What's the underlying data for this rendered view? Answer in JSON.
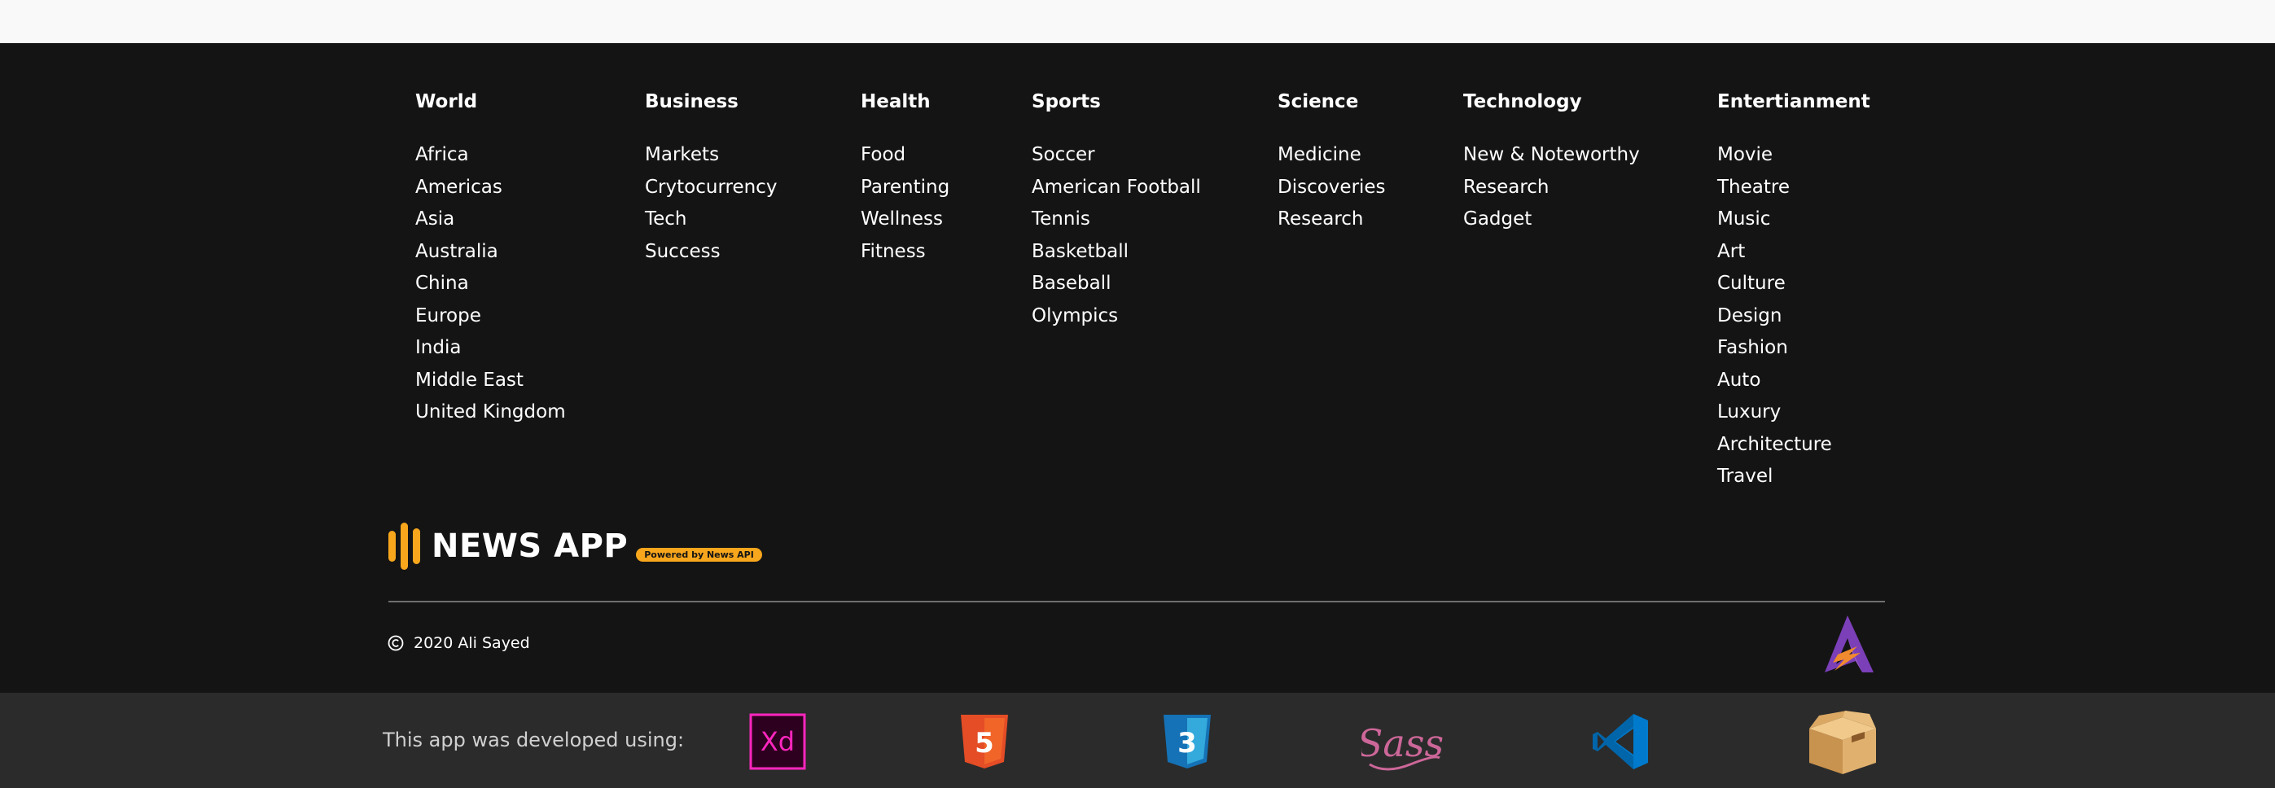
{
  "footer": {
    "columns": [
      {
        "heading": "World",
        "items": [
          "Africa",
          "Americas",
          "Asia",
          "Australia",
          "China",
          "Europe",
          "India",
          "Middle East",
          "United Kingdom"
        ]
      },
      {
        "heading": "Business",
        "items": [
          "Markets",
          "Crytocurrency",
          "Tech",
          "Success"
        ]
      },
      {
        "heading": "Health",
        "items": [
          "Food",
          "Parenting",
          "Wellness",
          "Fitness"
        ]
      },
      {
        "heading": "Sports",
        "items": [
          "Soccer",
          "American Football",
          "Tennis",
          "Basketball",
          "Baseball",
          "Olympics"
        ]
      },
      {
        "heading": "Science",
        "items": [
          "Medicine",
          "Discoveries",
          "Research"
        ]
      },
      {
        "heading": "Technology",
        "items": [
          "New & Noteworthy",
          "Research",
          "Gadget"
        ]
      },
      {
        "heading": "Entertianment",
        "items": [
          "Movie",
          "Theatre",
          "Music",
          "Art",
          "Culture",
          "Design",
          "Fashion",
          "Auto",
          "Luxury",
          "Architecture",
          "Travel"
        ]
      }
    ],
    "brand": {
      "name": "NEWS APP",
      "badge": "Powered by News API",
      "accent_color": "#f8a61c"
    },
    "copyright": {
      "icon": "copyright-icon",
      "text": "2020 Ali Sayed"
    },
    "creator_logo": "creator-logo-a-icon"
  },
  "tools_bar": {
    "label": "This app was developed using:",
    "tools": [
      {
        "icon": "adobe-xd-icon",
        "text": "Xd"
      },
      {
        "icon": "html5-icon",
        "text": "5"
      },
      {
        "icon": "css3-icon",
        "text": "3"
      },
      {
        "icon": "sass-icon",
        "text": "Sass"
      },
      {
        "icon": "vscode-icon"
      },
      {
        "icon": "parcel-box-icon"
      }
    ]
  },
  "colors": {
    "footer_bg": "#141414",
    "tools_bg": "#2b2b2b",
    "top_bg": "#f9f9f9"
  }
}
